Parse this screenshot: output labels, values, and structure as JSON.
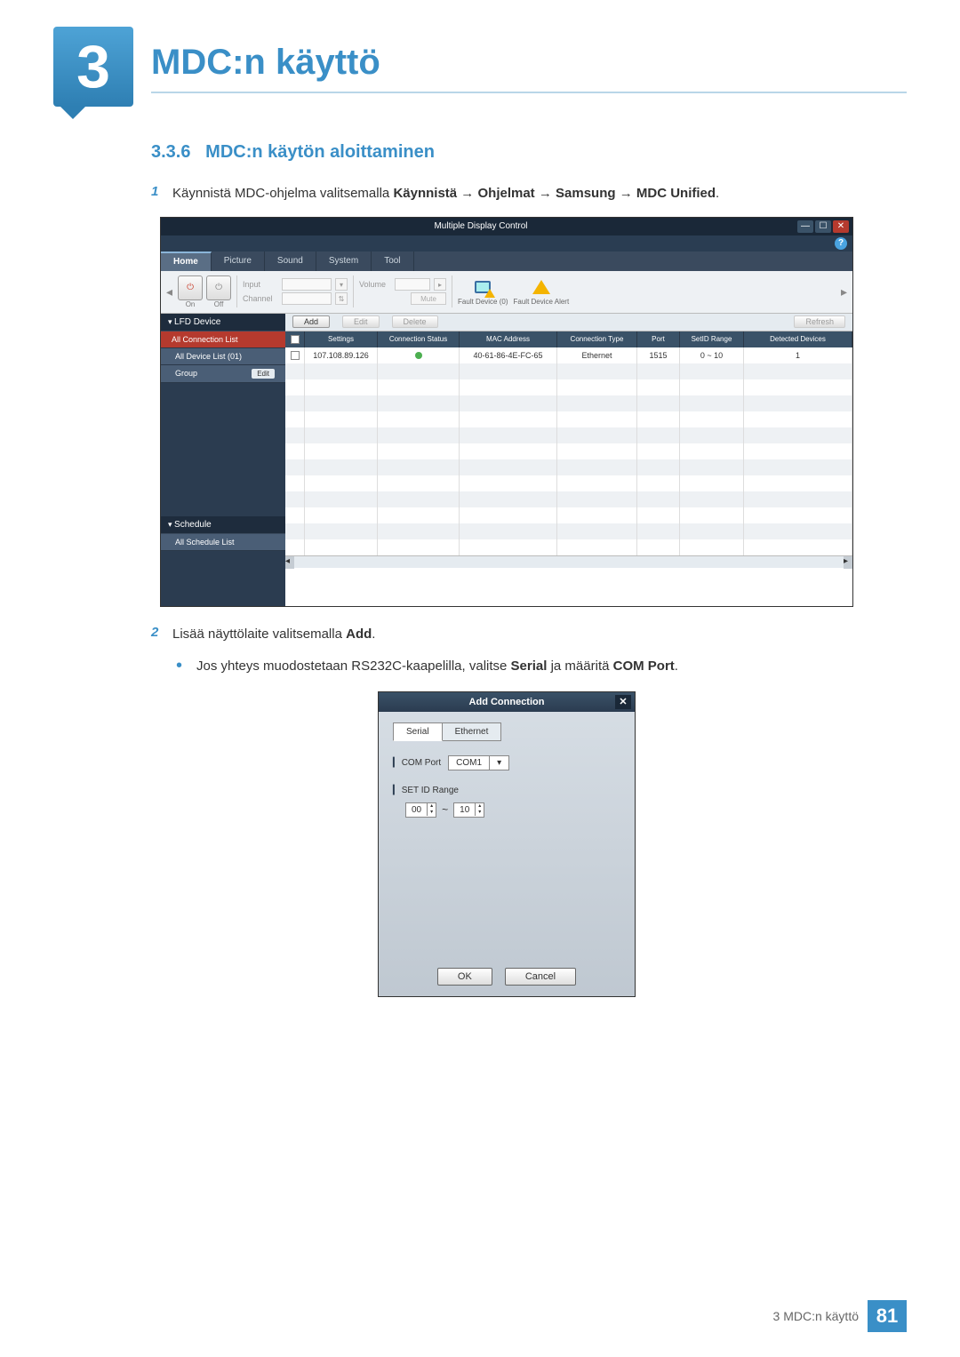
{
  "chapter": {
    "number": "3",
    "title": "MDC:n käyttö"
  },
  "section": {
    "number": "3.3.6",
    "title": "MDC:n käytön aloittaminen"
  },
  "steps": [
    {
      "num": "1",
      "parts": [
        {
          "t": "Käynnistä MDC-ohjelma valitsemalla ",
          "b": false
        },
        {
          "t": "Käynnistä",
          "b": true
        },
        {
          "t": " → ",
          "b": false
        },
        {
          "t": "Ohjelmat",
          "b": true
        },
        {
          "t": " → ",
          "b": false
        },
        {
          "t": "Samsung",
          "b": true
        },
        {
          "t": " → ",
          "b": false
        },
        {
          "t": "MDC Unified",
          "b": true
        },
        {
          "t": ".",
          "b": false
        }
      ]
    },
    {
      "num": "2",
      "parts": [
        {
          "t": "Lisää näyttölaite valitsemalla ",
          "b": false
        },
        {
          "t": "Add",
          "b": true
        },
        {
          "t": ".",
          "b": false
        }
      ]
    }
  ],
  "bullet": {
    "parts": [
      {
        "t": "Jos yhteys muodostetaan RS232C-kaapelilla, valitse ",
        "b": false
      },
      {
        "t": "Serial",
        "b": true
      },
      {
        "t": " ja määritä ",
        "b": false
      },
      {
        "t": "COM Port",
        "b": true
      },
      {
        "t": ".",
        "b": false
      }
    ]
  },
  "mdc": {
    "title": "Multiple Display Control",
    "tabs": [
      "Home",
      "Picture",
      "Sound",
      "System",
      "Tool"
    ],
    "toolbar": {
      "on": "On",
      "off": "Off",
      "input": "Input",
      "channel": "Channel",
      "volume": "Volume",
      "mute": "Mute",
      "fault1": "Fault Device (0)",
      "fault2": "Fault Device Alert"
    },
    "sidebar": {
      "lfd": "LFD Device",
      "all_conn": "All Connection List",
      "all_dev": "All Device List (01)",
      "group": "Group",
      "edit": "Edit",
      "schedule": "Schedule",
      "all_sched": "All Schedule List"
    },
    "actions": {
      "add": "Add",
      "edit": "Edit",
      "delete": "Delete",
      "refresh": "Refresh"
    },
    "columns": [
      "Settings",
      "Connection Status",
      "MAC Address",
      "Connection Type",
      "Port",
      "SetID Range",
      "Detected Devices"
    ],
    "row": {
      "settings": "107.108.89.126",
      "mac": "40-61-86-4E-FC-65",
      "type": "Ethernet",
      "port": "1515",
      "range": "0 ~ 10",
      "detected": "1"
    }
  },
  "addconn": {
    "title": "Add Connection",
    "tabs": [
      "Serial",
      "Ethernet"
    ],
    "comport_label": "COM Port",
    "comport_value": "COM1",
    "setid_label": "SET ID Range",
    "range_from": "00",
    "range_to": "10",
    "ok": "OK",
    "cancel": "Cancel"
  },
  "footer": {
    "text": "3 MDC:n käyttö",
    "page": "81"
  }
}
